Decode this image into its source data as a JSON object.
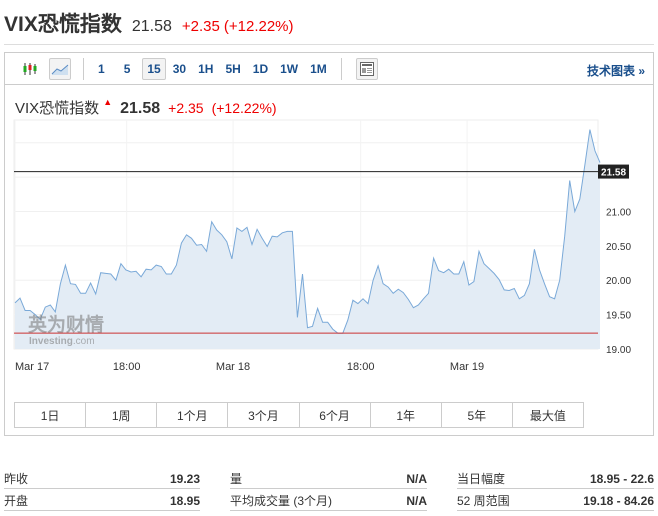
{
  "header": {
    "title": "VIX恐慌指数",
    "price": "21.58",
    "change": "+2.35",
    "change_pct": "(+12.22%)"
  },
  "toolbar": {
    "icons": [
      "candlestick-icon",
      "area-chart-icon"
    ],
    "timeframes": [
      "1",
      "5",
      "15",
      "30",
      "1H",
      "5H",
      "1D",
      "1W",
      "1M"
    ],
    "active_timeframe": "15",
    "table_icon": "table-icon",
    "tech_chart_label": "技术图表 »"
  },
  "chart_header": {
    "name": "VIX恐慌指数",
    "price": "21.58",
    "change": "+2.35",
    "change_pct": "(+12.22%)"
  },
  "watermark": {
    "brand_cn": "英为财情",
    "brand_en": "Investing.com"
  },
  "colors": {
    "up": "#e00000",
    "link": "#1a4f8c",
    "line": "#7aa9d8",
    "fill": "#e3ecf5"
  },
  "chart_data": {
    "type": "area",
    "ylim": [
      19.0,
      22.33
    ],
    "yticks": [
      "19.00",
      "19.50",
      "20.00",
      "20.50",
      "21.00"
    ],
    "xticks": [
      {
        "label": "Mar 17",
        "i": 0
      },
      {
        "label": "18:00",
        "i": 10.5
      },
      {
        "label": "Mar 18",
        "i": 20.5
      },
      {
        "label": "18:00",
        "i": 32.5
      },
      {
        "label": "Mar 19",
        "i": 42.5
      }
    ],
    "current_price": 21.58,
    "current_label": "21.58",
    "prev_close": 19.23,
    "values": [
      19.67,
      19.74,
      19.56,
      19.56,
      19.5,
      19.43,
      19.61,
      19.64,
      19.54,
      19.95,
      20.22,
      19.95,
      19.94,
      19.81,
      19.81,
      19.96,
      19.8,
      20.11,
      20.1,
      20.09,
      20.0,
      20.24,
      20.15,
      20.12,
      20.13,
      20.05,
      20.16,
      20.15,
      20.22,
      20.2,
      20.09,
      20.09,
      20.22,
      20.54,
      20.66,
      20.61,
      20.51,
      20.52,
      20.42,
      20.85,
      20.73,
      20.66,
      20.56,
      20.31,
      20.76,
      20.71,
      20.77,
      20.52,
      20.74,
      20.61,
      20.49,
      20.64,
      20.63,
      20.69,
      20.71,
      20.71,
      19.46,
      20.09,
      19.31,
      19.33,
      19.59,
      19.39,
      19.39,
      19.29,
      19.23,
      19.23,
      19.42,
      19.71,
      19.66,
      19.73,
      19.66,
      20.0,
      20.21,
      19.95,
      19.9,
      19.81,
      19.87,
      19.82,
      19.72,
      19.6,
      19.64,
      19.73,
      19.81,
      20.32,
      20.14,
      20.11,
      20.16,
      20.09,
      20.09,
      20.27,
      19.93,
      19.98,
      20.42,
      20.24,
      20.17,
      20.1,
      20.01,
      19.86,
      19.85,
      19.88,
      19.73,
      19.78,
      19.95,
      20.45,
      20.15,
      19.95,
      19.76,
      19.73,
      20.0,
      20.64,
      21.45,
      21.0,
      21.18,
      21.68,
      22.19,
      21.88,
      21.71
    ]
  },
  "ranges": [
    "1日",
    "1周",
    "1个月",
    "3个月",
    "6个月",
    "1年",
    "5年",
    "最大值"
  ],
  "stats": [
    [
      {
        "label": "昨收",
        "value": "19.23"
      },
      {
        "label": "量",
        "value": "N/A"
      },
      {
        "label": "当日幅度",
        "value": "18.95 - 22.6"
      }
    ],
    [
      {
        "label": "开盘",
        "value": "18.95"
      },
      {
        "label": "平均成交量 (3个月)",
        "value": "N/A"
      },
      {
        "label": "52 周范围",
        "value": "19.18 - 84.26"
      }
    ]
  ]
}
